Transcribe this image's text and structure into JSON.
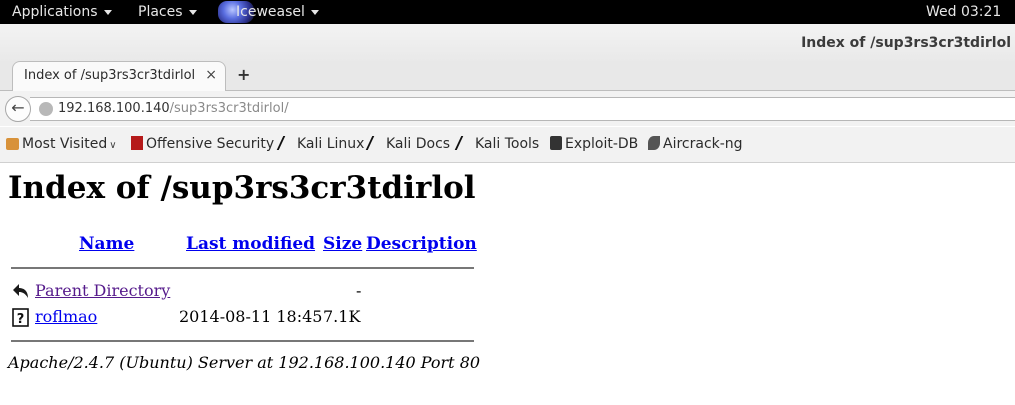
{
  "panel": {
    "applications": "Applications",
    "places": "Places",
    "app_name": "Iceweasel",
    "clock": "Wed 03:21"
  },
  "window": {
    "title": "Index of /sup3rs3cr3tdirlol"
  },
  "tab": {
    "label": "Index of /sup3rs3cr3tdirlol",
    "close": "×",
    "new_tab": "+"
  },
  "url": {
    "host": "192.168.100.140",
    "path": "/sup3rs3cr3tdirlol/"
  },
  "bookmarks": [
    {
      "label": "Most Visited",
      "icon": "folder-icon"
    },
    {
      "label": "Offensive Security",
      "icon": "offsec-icon"
    },
    {
      "label": "Kali Linux",
      "icon": "kali-dragon-icon"
    },
    {
      "label": "Kali Docs",
      "icon": "kali-dragon-icon"
    },
    {
      "label": "Kali Tools",
      "icon": "kali-dragon-icon"
    },
    {
      "label": "Exploit-DB",
      "icon": "exploitdb-icon"
    },
    {
      "label": "Aircrack-ng",
      "icon": "aircrack-icon"
    }
  ],
  "page": {
    "heading": "Index of /sup3rs3cr3tdirlol",
    "columns": [
      "Name",
      "Last modified",
      "Size",
      "Description"
    ],
    "rows": [
      {
        "name": "Parent Directory",
        "modified": "",
        "size": "-",
        "description": "",
        "icon": "back-arrow-icon"
      },
      {
        "name": "roflmao",
        "modified": "2014-08-11 18:45",
        "size": "7.1K",
        "description": "",
        "icon": "unknown-file-icon"
      }
    ],
    "address": "Apache/2.4.7 (Ubuntu) Server at 192.168.100.140 Port 80"
  }
}
